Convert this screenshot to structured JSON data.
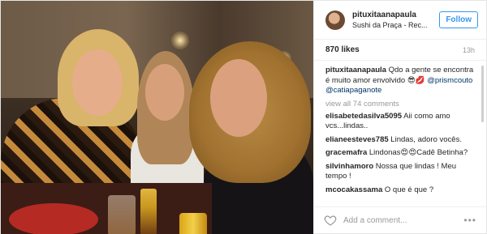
{
  "post": {
    "username": "pituxitaanapaula",
    "location": "Sushi da Praça - Rec...",
    "follow_label": "Follow",
    "likes": "870 likes",
    "time": "13h"
  },
  "caption": {
    "user": "pituxitaanapaula",
    "text": "Qdo a gente se encontra é muito amor envolvido 😎💋",
    "mention1": "@prismcouto",
    "mention2": "@catiapaganote"
  },
  "view_all": "view all 74 comments",
  "comments": [
    {
      "user": "elisabetedasilva5095",
      "text": "Aii como amo vcs...lindas.."
    },
    {
      "user": "elianeesteves785",
      "text": "Lindas, adoro vocês."
    },
    {
      "user": "gracemafra",
      "text": "Lindonas😍😍Cadê Betinha?"
    },
    {
      "user": "silvinhamoro",
      "text": "Nossa que lindas ! Meu tempo !"
    },
    {
      "user": "mcocakassama",
      "text": "O que é que ?"
    }
  ],
  "footer": {
    "add_comment_placeholder": "Add a comment...",
    "more_label": "•••"
  },
  "icons": {
    "heart": "heart-icon",
    "more": "more-options-icon"
  },
  "colors": {
    "accent": "#3897f0",
    "mention": "#003569",
    "muted": "#999999"
  }
}
